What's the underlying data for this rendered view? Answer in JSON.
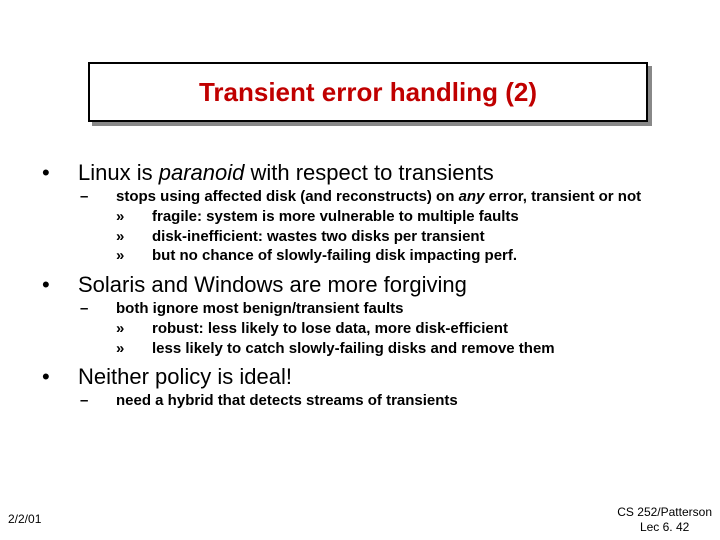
{
  "title": "Transient error handling (2)",
  "b1": {
    "prefix": "Linux is ",
    "italic": "paranoid",
    "suffix": " with respect to transients"
  },
  "s1": {
    "prefix": "stops using affected disk (and reconstructs) on ",
    "italic": "any",
    "suffix": " error, transient or not"
  },
  "ss1": "fragile: system is more vulnerable to multiple faults",
  "ss2": "disk-inefficient: wastes two disks per transient",
  "ss3": "but no chance of slowly-failing disk impacting perf.",
  "b2": "Solaris and Windows are more forgiving",
  "s2": "both ignore most benign/transient faults",
  "ss4": "robust: less likely to lose data, more disk-efficient",
  "ss5": "less likely to catch slowly-failing disks and remove them",
  "b3": "Neither policy is ideal!",
  "s3": "need a hybrid that detects streams of transients",
  "footer_left": "2/2/01",
  "footer_right_line1": "CS 252/Patterson",
  "footer_right_line2": "Lec 6. 42"
}
